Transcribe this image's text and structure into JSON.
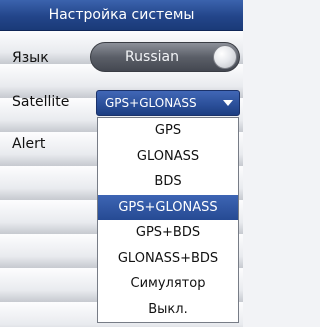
{
  "header": {
    "title": "Настройка системы"
  },
  "rows": {
    "language": {
      "label": "Язык",
      "value": "Russian"
    },
    "satellite": {
      "label": "Satellite",
      "value": "GPS+GLONASS"
    },
    "alert": {
      "label": "Alert"
    }
  },
  "dropdown": {
    "options": [
      "GPS",
      "GLONASS",
      "BDS",
      "GPS+GLONASS",
      "GPS+BDS",
      "GLONASS+BDS",
      "Симулятор",
      "Выкл."
    ],
    "selected": "GPS+GLONASS"
  },
  "icons": {
    "language_toggle": "toggle-knob-icon",
    "dropdown_arrow": "chevron-down-icon"
  },
  "colors": {
    "title_bar": "#23458a",
    "selection": "#2a4e98",
    "pill": "#5b5f68"
  }
}
